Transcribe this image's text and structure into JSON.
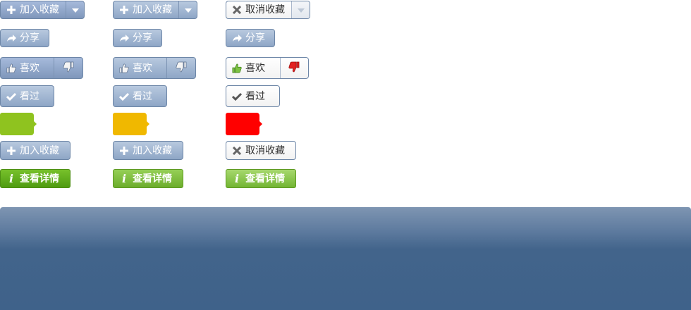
{
  "buttons": {
    "favorite_add": "加入收藏",
    "favorite_cancel": "取消收藏",
    "share": "分享",
    "like": "喜欢",
    "watched": "看过",
    "details": "查看详情"
  },
  "colors": {
    "tag_green": "#8fc31f",
    "tag_yellow": "#f0b800",
    "tag_red": "#ff0000",
    "button_border": "#6d86a7",
    "banner": "#42648b"
  },
  "icons": {
    "plus": "plus-icon",
    "dropdown": "caret-down-icon",
    "close": "x-icon",
    "share": "share-arrow-icon",
    "like": "thumbs-up-icon",
    "dislike": "thumbs-down-icon",
    "check": "checkmark-icon",
    "info": "info-icon"
  }
}
